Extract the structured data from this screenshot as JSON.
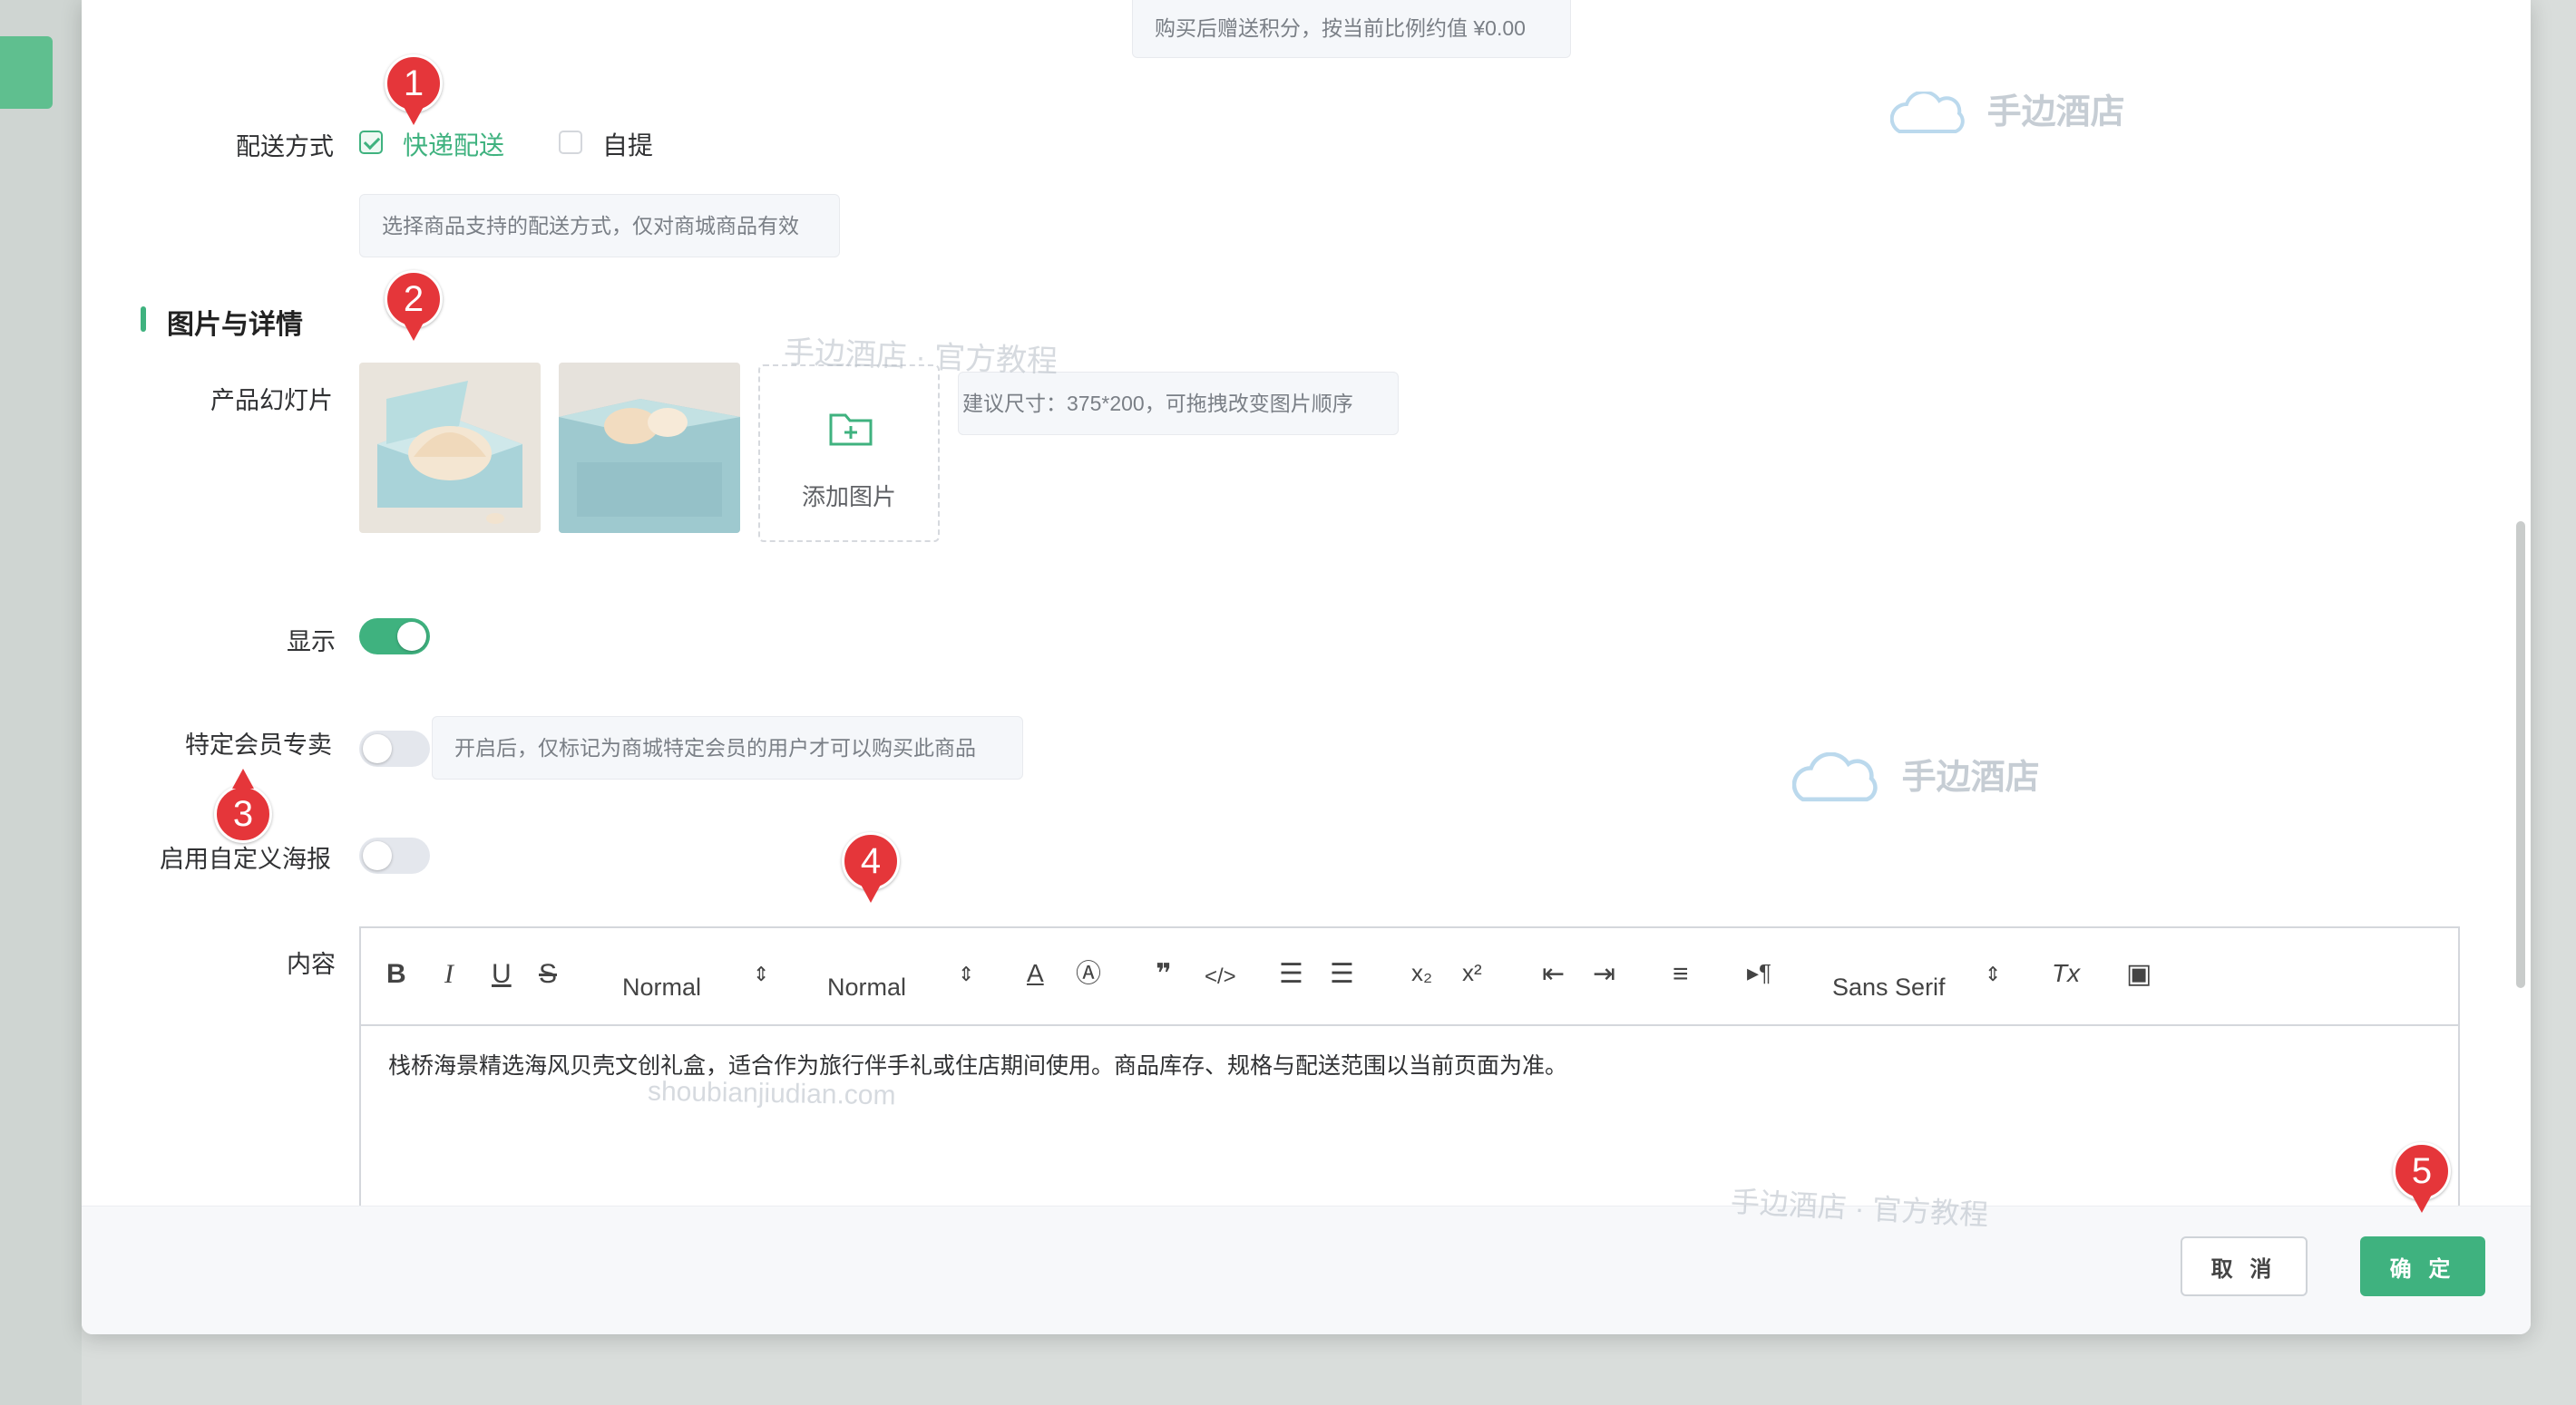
{
  "points_tip": "购买后赠送积分，按当前比例约值 ¥0.00",
  "delivery": {
    "label": "配送方式",
    "options": [
      {
        "label": "快递配送",
        "checked": true
      },
      {
        "label": "自提",
        "checked": false
      }
    ],
    "tip": "选择商品支持的配送方式，仅对商城商品有效"
  },
  "section": {
    "title": "图片与详情"
  },
  "slides": {
    "label": "产品幻灯片",
    "add_label": "添加图片",
    "tip": "建议尺寸：375*200，可拖拽改变图片顺序"
  },
  "display": {
    "label": "显示",
    "on": true
  },
  "member_only": {
    "label": "特定会员专卖",
    "on": false,
    "tip": "开启后，仅标记为商城特定会员的用户才可以购买此商品"
  },
  "poster": {
    "label": "启用自定义海报",
    "on": false
  },
  "content": {
    "label": "内容",
    "toolbar": {
      "header_select": "Normal",
      "size_select": "Normal",
      "font_select": "Sans Serif"
    },
    "body": "栈桥海景精选海风贝壳文创礼盒，适合作为旅行伴手礼或住店期间使用。商品库存、规格与配送范围以当前页面为准。"
  },
  "buttons": {
    "cancel": "取 消",
    "ok": "确 定"
  },
  "markers": [
    "1",
    "2",
    "3",
    "4",
    "5"
  ],
  "watermarks": {
    "logo": "手边酒店",
    "tutorial": "手边酒店 · 官方教程",
    "domain": "shoubianjiudian.com"
  },
  "colors": {
    "accent": "#3fb27f",
    "marker": "#e5363a"
  }
}
